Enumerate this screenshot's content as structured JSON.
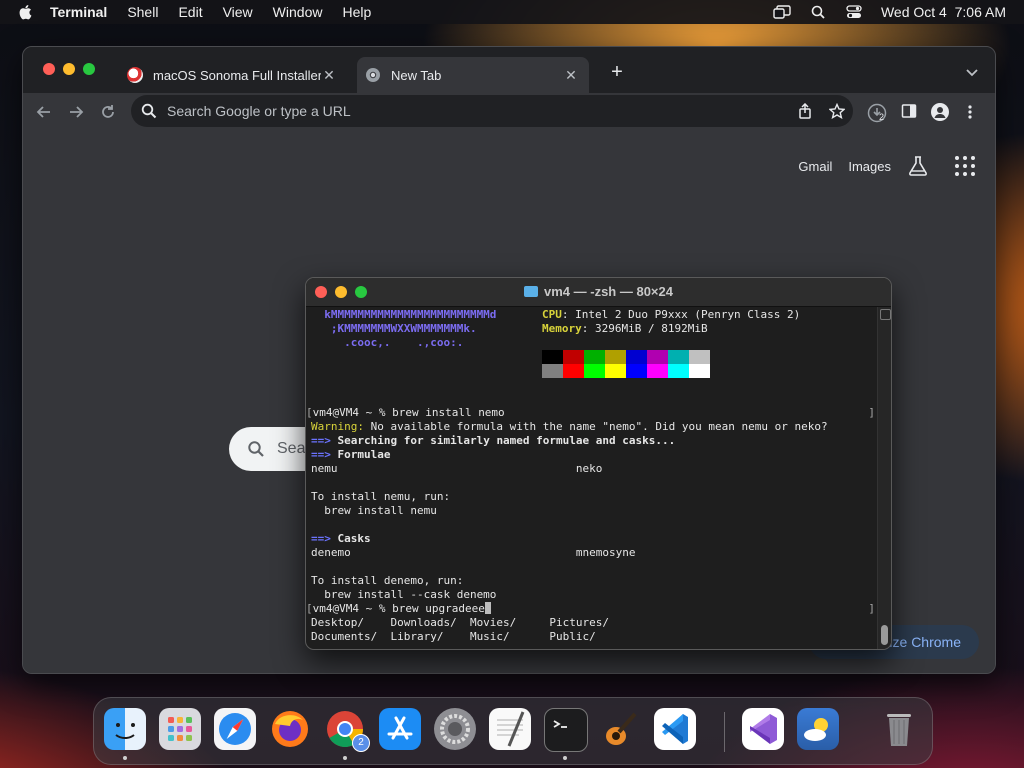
{
  "menubar": {
    "app_name": "Terminal",
    "items": [
      "Shell",
      "Edit",
      "View",
      "Window",
      "Help"
    ],
    "datetime": "Wed Oct 4  7:06 AM"
  },
  "chrome": {
    "tabs": [
      {
        "title": "macOS Sonoma Full Installer D",
        "active": false
      },
      {
        "title": "New Tab",
        "active": true
      }
    ],
    "omnibox_placeholder": "Search Google or type a URL",
    "ntp_links": {
      "gmail": "Gmail",
      "images": "Images"
    },
    "search_pill_text": "Sea",
    "customize_label": "ize Chrome",
    "download_badge": "2"
  },
  "terminal": {
    "title": "vm4 — -zsh — 80×24",
    "neofetch": {
      "art_line1": "  kMMMMMMMMMMMMMMMMMMMMMMMMd",
      "art_line2": "   ;KMMMMMMMWXXWMMMMMMMk.",
      "art_line3": "     .cooc,.    .,coo:.",
      "cpu_label": "CPU",
      "cpu_value": ": Intel 2 Duo P9xxx (Penryn Class 2)",
      "memory_label": "Memory",
      "memory_value": ": 3296MiB / 8192MiB"
    },
    "lines": {
      "cmd1": "vm4@VM4 ~ % brew install nemo",
      "warning_label": "Warning:",
      "warning_text": " No available formula with the name \"nemo\". Did you mean nemu or neko?",
      "arrow": "==>",
      "searching": " Searching for similarly named formulae and casks...",
      "formulae_hdr": " Formulae",
      "formulae_row": "nemu                                    neko",
      "install_nemu": "To install nemu, run:",
      "install_nemu_cmd": "  brew install nemu",
      "casks_hdr": " Casks",
      "casks_row": "denemo                                  mnemosyne",
      "install_denemo": "To install denemo, run:",
      "install_denemo_cmd": "  brew install --cask denemo",
      "cmd2": "vm4@VM4 ~ % brew upgradeee",
      "ls_row1": "Desktop/    Downloads/  Movies/     Pictures/",
      "ls_row2": "Documents/  Library/    Music/      Public/"
    },
    "palette_top": [
      "#000000",
      "#c00000",
      "#00b000",
      "#b0a000",
      "#0000d0",
      "#b000b0",
      "#00b0b0",
      "#c0c0c0"
    ],
    "palette_bottom": [
      "#808080",
      "#ff0000",
      "#00ff00",
      "#ffff00",
      "#0000ff",
      "#ff00ff",
      "#00ffff",
      "#ffffff"
    ]
  },
  "dock": {
    "apps": [
      "Finder",
      "Launchpad",
      "Safari",
      "Firefox",
      "Google Chrome",
      "App Store",
      "System Settings",
      "TextEdit",
      "Terminal",
      "GarageBand",
      "Visual Studio Code",
      "Visual Studio",
      "Weather",
      "Trash"
    ],
    "chrome_badge": "2"
  }
}
